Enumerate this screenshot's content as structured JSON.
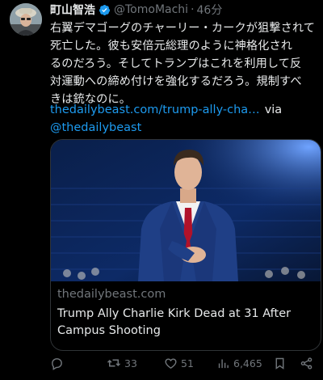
{
  "post": {
    "display_name": "町山智浩",
    "handle": "@TomoMachi",
    "separator": "·",
    "time": "46分",
    "text_lines": [
      "右翼デマゴーグのチャーリー・カークが狙撃されて",
      "死亡した。彼も安倍元総理のように神格化され",
      "るのだろう。そしてトランプはこれを利用して反",
      "対運動への締め付けを強化するだろう。規制すべ",
      "きは銃なのに。"
    ],
    "link_text": "thedailybeast.com/trump-ally-cha…",
    "via_text": "via",
    "mention": "@thedailybeast"
  },
  "card": {
    "domain": "thedailybeast.com",
    "title_line1": "Trump Ally Charlie Kirk Dead at 31 After",
    "title_line2": "Campus Shooting"
  },
  "actions": {
    "reply_icon": "reply-icon",
    "repost_icon": "repost-icon",
    "repost_count": "33",
    "like_icon": "like-icon",
    "like_count": "51",
    "views_icon": "views-icon",
    "views_count": "6,465",
    "bookmark_icon": "bookmark-icon",
    "share_icon": "share-icon"
  },
  "colors": {
    "background": "#000000",
    "text": "#e7e9ea",
    "muted": "#71767b",
    "link": "#1d9bf0",
    "verified": "#1d9bf0",
    "card_border": "#2f3336"
  }
}
